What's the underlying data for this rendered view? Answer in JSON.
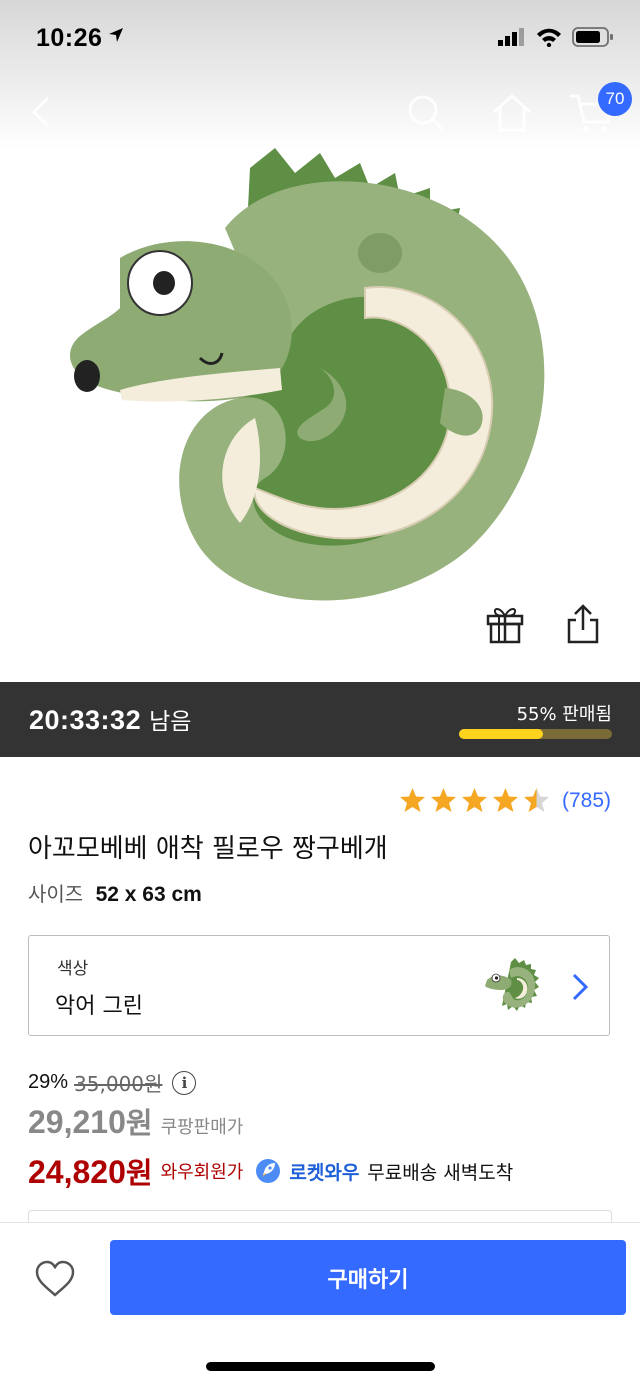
{
  "status": {
    "time": "10:26"
  },
  "nav": {
    "cart_count": "70"
  },
  "deal": {
    "remaining_time": "20:33:32",
    "remaining_suffix": "남음",
    "sold_label": "55% 판매됨",
    "sold_fraction": 0.55
  },
  "rating": {
    "stars": 4.5,
    "review_count": "(785)"
  },
  "product": {
    "title": "아꼬모베베 애착 필로우 짱구베개",
    "size_label": "사이즈",
    "size_value": "52 x 63 cm"
  },
  "option": {
    "label": "색상",
    "value": "악어 그린"
  },
  "price": {
    "discount_percent": "29%",
    "original_price": "35,000원",
    "sale_amount": "29,210",
    "sale_unit": "원",
    "sale_seller_label": "쿠팡판매가",
    "member_amount": "24,820",
    "member_unit": "원",
    "member_label": "와우회원가",
    "rocket_label": "로켓와우",
    "shipping_text": "무료배송 새벽도착"
  },
  "actions": {
    "buy_label": "구매하기"
  },
  "colors": {
    "accent": "#346aff",
    "member_price": "#ae0000",
    "timer_bg": "#333333",
    "progress": "#ffd21e",
    "star": "#f5a623"
  },
  "icons": [
    "back-icon",
    "search-icon",
    "home-icon",
    "cart-icon",
    "gift-icon",
    "share-icon",
    "star-icon",
    "info-icon",
    "chevron-right-icon",
    "rocket-icon",
    "heart-icon"
  ]
}
